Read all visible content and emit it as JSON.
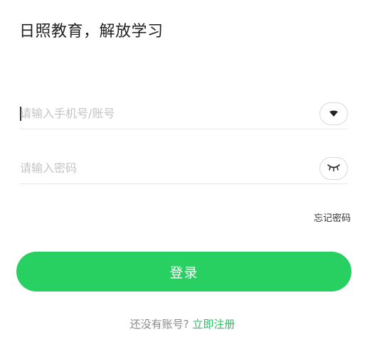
{
  "header": {
    "title": "日照教育，解放学习"
  },
  "login_form": {
    "account_placeholder": "请输入手机号/账号",
    "account_value": "",
    "password_placeholder": "请输入密码",
    "password_value": "",
    "forgot_label": "忘记密码",
    "submit_label": "登录"
  },
  "footer": {
    "no_account_text": "还没有账号?",
    "register_link": "立即注册"
  },
  "icons": {
    "account_toggle": "chevron-down-icon",
    "password_toggle": "eye-closed-icon"
  },
  "colors": {
    "accent": "#28d062",
    "link": "#28c062"
  }
}
